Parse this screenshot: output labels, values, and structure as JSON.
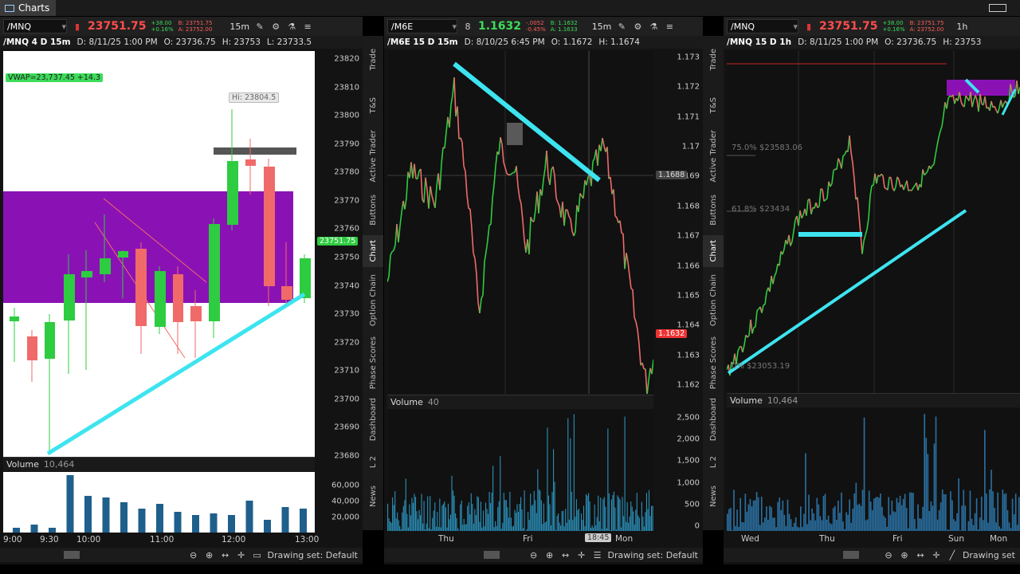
{
  "app": {
    "title": "Charts"
  },
  "panels": [
    {
      "symbol": "/MNQ",
      "price": "23751.75",
      "change_abs": "+38.00",
      "change_pct": "+0.16%",
      "bid": "B: 23751.75",
      "ask": "A: 23752.00",
      "timeframe": "15m",
      "info": {
        "title": "/MNQ 4 D 15m",
        "date": "D: 8/11/25 1:00 PM",
        "open": "O: 23736.75",
        "high": "H: 23753",
        "low": "L: 23733.5"
      },
      "vwap_label": "VWAP=23,737.45 +14.3",
      "hi_label": "Hi: 23804.5",
      "price_tag": "23751.75",
      "y_ticks": [
        "23820",
        "23810",
        "23800",
        "23790",
        "23780",
        "23770",
        "23760",
        "23750",
        "23740",
        "23730",
        "23720",
        "23710",
        "23700",
        "23690",
        "23680"
      ],
      "volume": {
        "label": "Volume",
        "value": "10,464",
        "ticks": [
          "60,000",
          "40,000",
          "20,000"
        ]
      },
      "x_ticks": [
        "9:00",
        "9:30",
        "10:00",
        "11:00",
        "12:00",
        "13:00"
      ],
      "drawing_set": "Drawing set: Default"
    },
    {
      "symbol": "/M6E",
      "price": "1.1632",
      "change_abs": "-.0052",
      "change_pct": "-0.45%",
      "bid": "B: 1.1632",
      "ask": "A: 1.1633",
      "timeframe": "15m",
      "info": {
        "title": "/M6E 15 D 15m",
        "date": "D: 8/10/25 6:45 PM",
        "open": "O: 1.1672",
        "high": "H: 1.1674"
      },
      "crosshair_tag": "1.1688",
      "price_tag": "1.1632",
      "y_ticks": [
        "1.173",
        "1.172",
        "1.171",
        "1.17",
        "1.169",
        "1.168",
        "1.167",
        "1.166",
        "1.165",
        "1.164",
        "1.163",
        "1.162"
      ],
      "volume": {
        "label": "Volume",
        "value": "40",
        "ticks": [
          "2,500",
          "2,000",
          "1,500",
          "1,000",
          "500",
          "0"
        ]
      },
      "x_ticks": [
        "Thu",
        "Fri",
        "Mon"
      ],
      "cursor_time": "18:45",
      "drawing_set": "Drawing set: Default"
    },
    {
      "symbol": "/MNQ",
      "price": "23751.75",
      "change_abs": "+38.00",
      "change_pct": "+0.16%",
      "bid": "B: 23751.75",
      "ask": "A: 23752.00",
      "timeframe": "1h",
      "info": {
        "title": "/MNQ 15 D 1h",
        "date": "D: 8/11/25 1:00 PM",
        "open": "O: 23736.75",
        "high": "H: 23753"
      },
      "fib_levels": [
        "75.0%",
        "$23583.06",
        "61.8%",
        "$23434",
        "0%",
        "$23053.19"
      ],
      "volume": {
        "label": "Volume",
        "value": "10,464"
      },
      "x_ticks": [
        "Wed",
        "Thu",
        "Fri",
        "Sun",
        "Mon"
      ],
      "drawing_set": "Drawing set"
    }
  ],
  "sidebar": [
    "Trade",
    "T&S",
    "Active Trader",
    "Buttons",
    "Chart",
    "Option Chain",
    "Phase Scores",
    "Dashboard",
    "L 2",
    "News"
  ]
}
